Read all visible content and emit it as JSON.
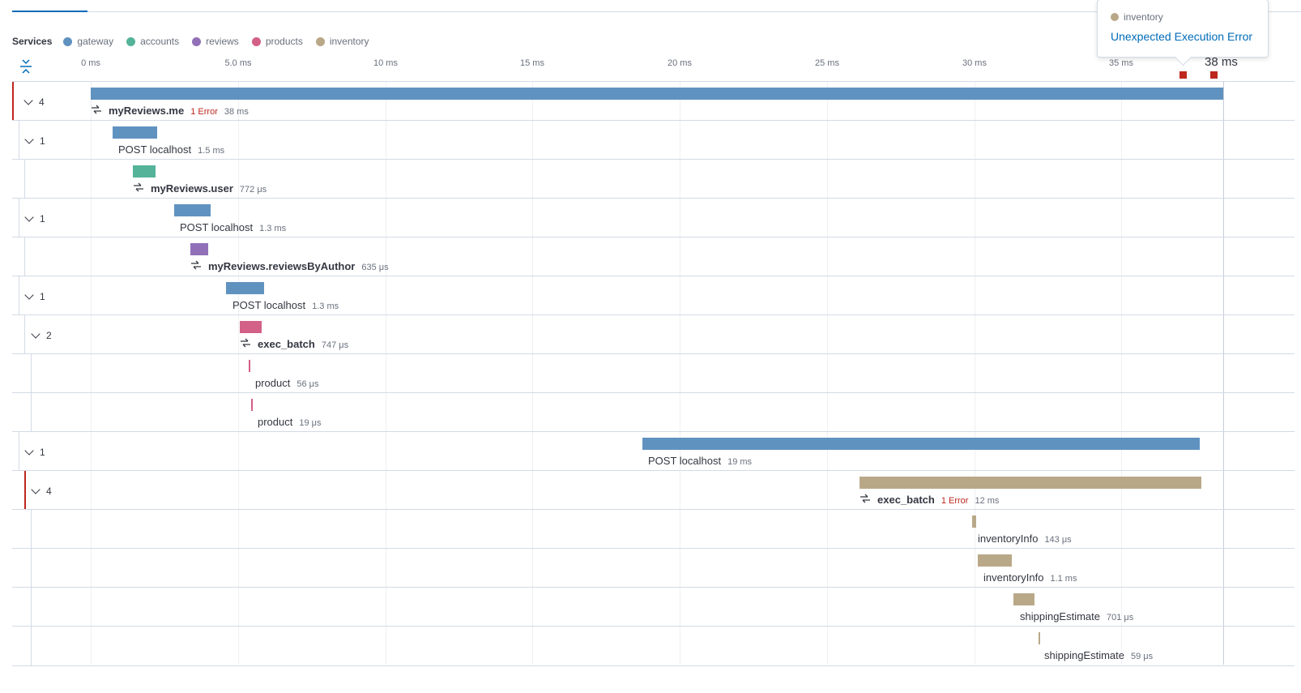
{
  "legend": {
    "title": "Services",
    "services": [
      {
        "name": "gateway",
        "color": "#6092c0"
      },
      {
        "name": "accounts",
        "color": "#54b399"
      },
      {
        "name": "reviews",
        "color": "#9170b8"
      },
      {
        "name": "products",
        "color": "#d36086"
      },
      {
        "name": "inventory",
        "color": "#b9a888"
      }
    ]
  },
  "axis": {
    "ticks": [
      "0 ms",
      "5.0 ms",
      "10 ms",
      "15 ms",
      "20 ms",
      "25 ms",
      "30 ms",
      "35 ms"
    ],
    "end_label": "38 ms",
    "error_marker_count": 2
  },
  "popover": {
    "service": "inventory",
    "service_color": "#b9a888",
    "message": "Unexpected Execution Error"
  },
  "spans": [
    {
      "toggle": "4",
      "name": "myReviews.me",
      "duration": "38 ms",
      "error": "1 Error",
      "color": "#6092c0",
      "sync": true,
      "bold": true
    },
    {
      "toggle": "1",
      "name": "POST localhost",
      "duration": "1.5 ms",
      "error": "",
      "color": "#6092c0",
      "sync": false,
      "bold": false
    },
    {
      "toggle": "",
      "name": "myReviews.user",
      "duration": "772 μs",
      "error": "",
      "color": "#54b399",
      "sync": true,
      "bold": true
    },
    {
      "toggle": "1",
      "name": "POST localhost",
      "duration": "1.3 ms",
      "error": "",
      "color": "#6092c0",
      "sync": false,
      "bold": false
    },
    {
      "toggle": "",
      "name": "myReviews.reviewsByAuthor",
      "duration": "635 μs",
      "error": "",
      "color": "#9170b8",
      "sync": true,
      "bold": true
    },
    {
      "toggle": "1",
      "name": "POST localhost",
      "duration": "1.3 ms",
      "error": "",
      "color": "#6092c0",
      "sync": false,
      "bold": false
    },
    {
      "toggle": "2",
      "name": "exec_batch",
      "duration": "747 μs",
      "error": "",
      "color": "#d36086",
      "sync": true,
      "bold": true
    },
    {
      "toggle": "",
      "name": "product",
      "duration": "56 μs",
      "error": "",
      "color": "#d36086",
      "sync": false,
      "bold": false
    },
    {
      "toggle": "",
      "name": "product",
      "duration": "19 μs",
      "error": "",
      "color": "#d36086",
      "sync": false,
      "bold": false
    },
    {
      "toggle": "1",
      "name": "POST localhost",
      "duration": "19 ms",
      "error": "",
      "color": "#6092c0",
      "sync": false,
      "bold": false
    },
    {
      "toggle": "4",
      "name": "exec_batch",
      "duration": "12 ms",
      "error": "1 Error",
      "color": "#b9a888",
      "sync": true,
      "bold": true
    },
    {
      "toggle": "",
      "name": "inventoryInfo",
      "duration": "143 μs",
      "error": "",
      "color": "#b9a888",
      "sync": false,
      "bold": false
    },
    {
      "toggle": "",
      "name": "inventoryInfo",
      "duration": "1.1 ms",
      "error": "",
      "color": "#b9a888",
      "sync": false,
      "bold": false
    },
    {
      "toggle": "",
      "name": "shippingEstimate",
      "duration": "701 μs",
      "error": "",
      "color": "#b9a888",
      "sync": false,
      "bold": false
    },
    {
      "toggle": "",
      "name": "shippingEstimate",
      "duration": "59 μs",
      "error": "",
      "color": "#b9a888",
      "sync": false,
      "bold": false
    }
  ]
}
